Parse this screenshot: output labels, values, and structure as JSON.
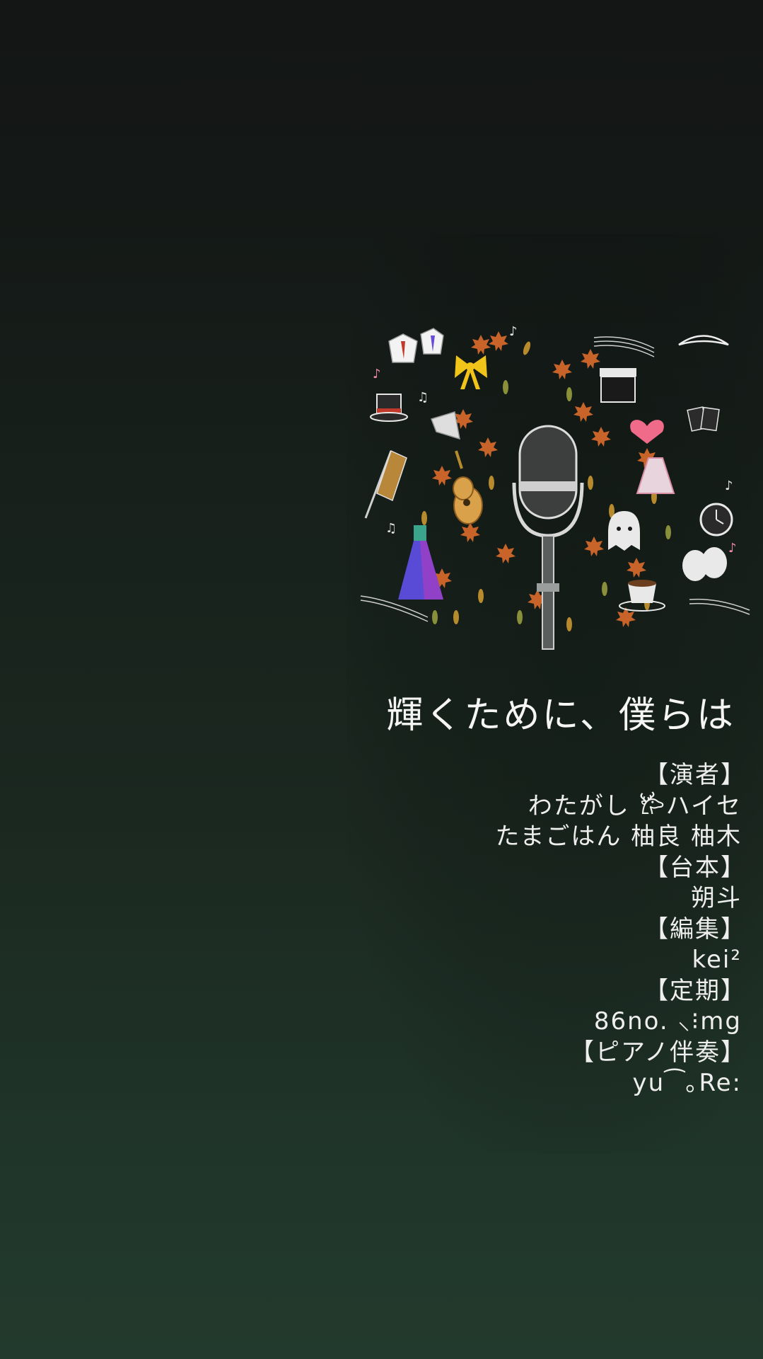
{
  "title": "輝くために、僕らは",
  "credits": {
    "cast_heading": "【演者】",
    "cast_line_1": "わたがし 𐂂ハイセ",
    "cast_line_2": "たまごはん 柚良 柚木",
    "script_heading": "【台本】",
    "script_name": "朔斗",
    "edit_heading": "【編集】",
    "edit_name": "kei²",
    "regular_heading": "【定期】",
    "regular_name": "86no. ⸜⁝mg",
    "piano_heading": "【ピアノ伴奏】",
    "piano_name": "yu⁀｡Re:"
  },
  "artwork": {
    "icons": [
      "microphone-icon",
      "top-hat-icon",
      "bow-icon",
      "clapperboard-icon",
      "tiara-icon",
      "heart-icon",
      "playing-cards-icon",
      "megaphone-icon",
      "guitar-icon",
      "dress-icon",
      "pocket-watch-icon",
      "ghost-icon",
      "theater-masks-icon",
      "coffee-cup-icon",
      "music-staff-icon",
      "maple-leaf-icon",
      "flag-icon",
      "costume-icon"
    ],
    "colors": {
      "leaf_orange": "#c8642a",
      "leaf_gold": "#b88a2e",
      "leaf_olive": "#8a8f3a",
      "chalk_white": "#e8e8e8",
      "bow_yellow": "#f0c419",
      "heart_pink": "#f06a8a",
      "dress_blue": "#4b6bd6",
      "dress_purple": "#9b3fc6"
    }
  }
}
